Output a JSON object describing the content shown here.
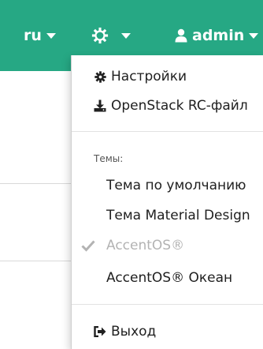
{
  "navbar": {
    "language": "ru",
    "theme_icon": "gear-icon",
    "user": {
      "icon": "user-icon",
      "name": "admin"
    }
  },
  "dropdown": {
    "settings": {
      "icon": "cog-icon",
      "label": "Настройки"
    },
    "rc_file": {
      "icon": "download-icon",
      "label": "OpenStack RC-файл"
    },
    "themes_header": "Темы:",
    "themes": [
      {
        "label": "Тема по умолчанию",
        "active": false
      },
      {
        "label": "Тема Material Design",
        "active": false
      },
      {
        "label": "AccentOS®",
        "active": true
      },
      {
        "label": "AccentOS® Океан",
        "active": false
      }
    ],
    "logout": {
      "icon": "sign-out-icon",
      "label": "Выход"
    }
  },
  "colors": {
    "navbar_bg": "#26a884",
    "active_theme_text": "#b3b3b3",
    "check_icon": "#b3b3b3"
  }
}
